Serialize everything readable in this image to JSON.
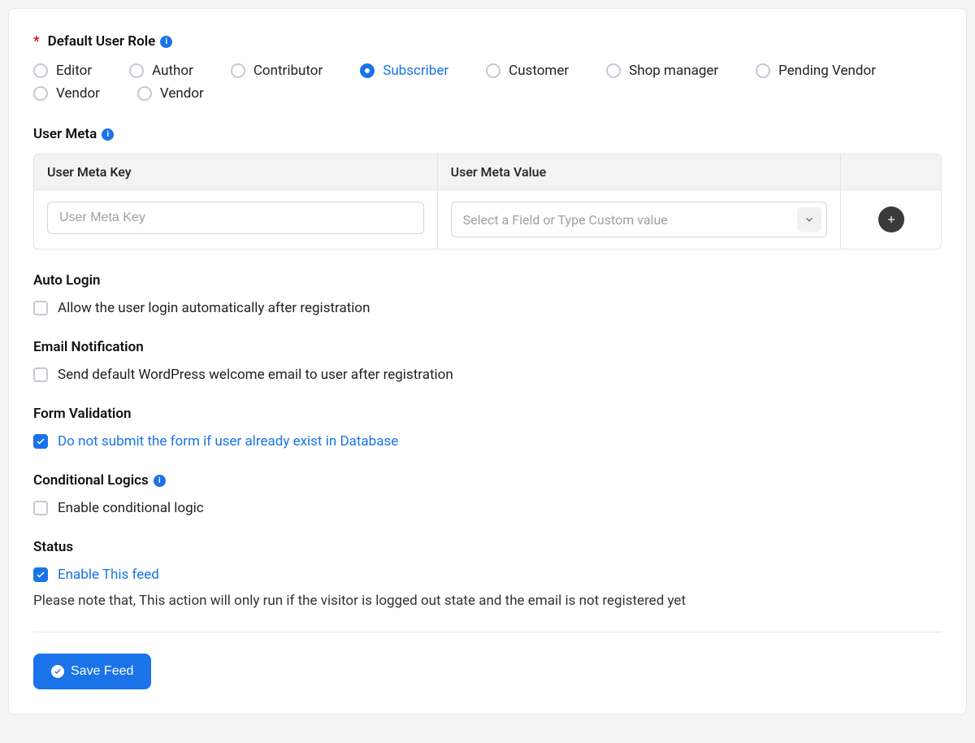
{
  "roleSection": {
    "label": "Default User Role",
    "roles": [
      {
        "label": "Editor",
        "selected": false
      },
      {
        "label": "Author",
        "selected": false
      },
      {
        "label": "Contributor",
        "selected": false
      },
      {
        "label": "Subscriber",
        "selected": true
      },
      {
        "label": "Customer",
        "selected": false
      },
      {
        "label": "Shop manager",
        "selected": false
      },
      {
        "label": "Pending Vendor",
        "selected": false
      },
      {
        "label": "Vendor",
        "selected": false
      },
      {
        "label": "Vendor",
        "selected": false
      }
    ]
  },
  "userMeta": {
    "label": "User Meta",
    "keyHeader": "User Meta Key",
    "valueHeader": "User Meta Value",
    "keyPlaceholder": "User Meta Key",
    "valuePlaceholder": "Select a Field or Type Custom value"
  },
  "autoLogin": {
    "label": "Auto Login",
    "option": "Allow the user login automatically after registration",
    "checked": false
  },
  "emailNotification": {
    "label": "Email Notification",
    "option": "Send default WordPress welcome email to user after registration",
    "checked": false
  },
  "formValidation": {
    "label": "Form Validation",
    "option": "Do not submit the form if user already exist in Database",
    "checked": true
  },
  "conditionalLogics": {
    "label": "Conditional Logics",
    "option": "Enable conditional logic",
    "checked": false
  },
  "status": {
    "label": "Status",
    "option": "Enable This feed",
    "checked": true,
    "note": "Please note that, This action will only run if the visitor is logged out state and the email is not registered yet"
  },
  "saveButton": "Save Feed"
}
